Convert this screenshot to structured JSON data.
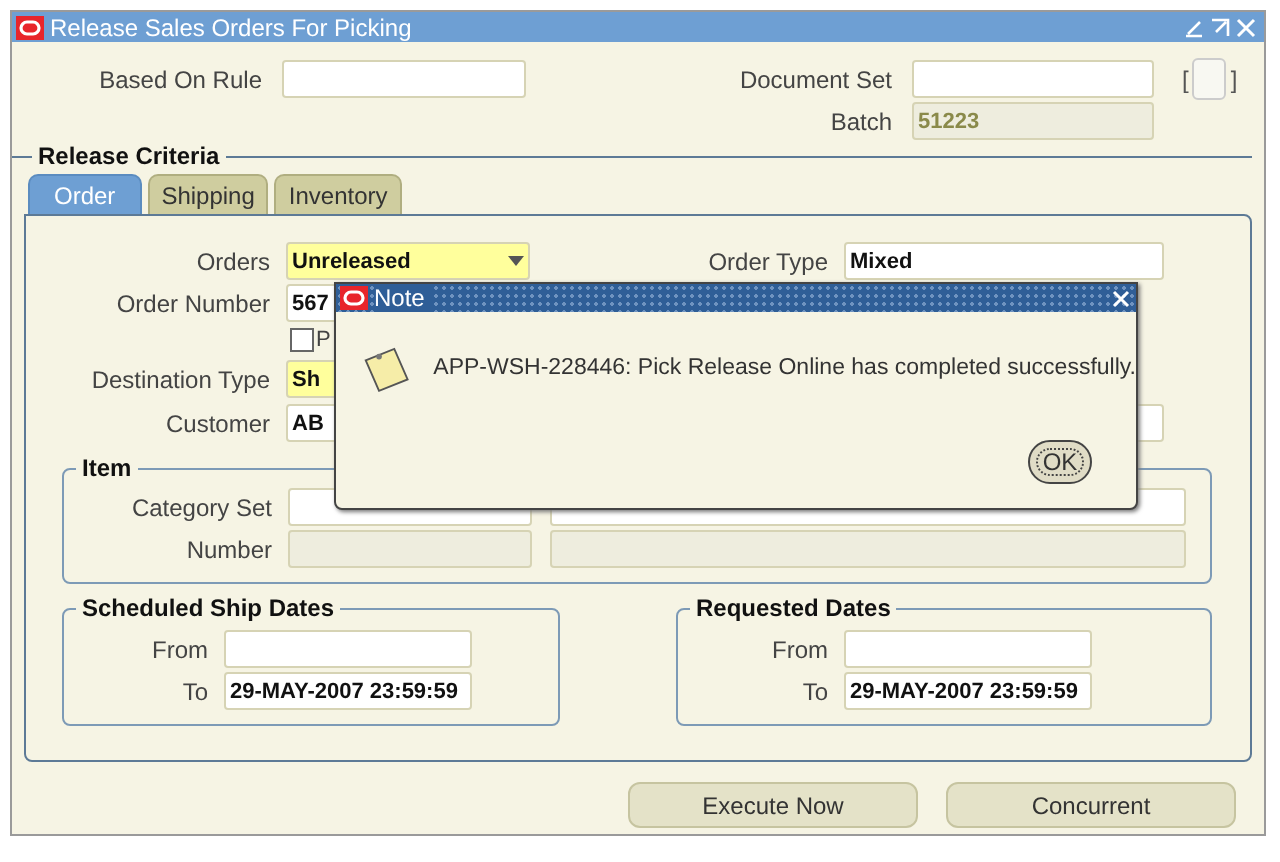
{
  "window": {
    "title": "Release Sales Orders For Picking"
  },
  "header": {
    "based_on_rule": {
      "label": "Based On Rule"
    },
    "document_set": {
      "label": "Document Set"
    },
    "flexfield": {
      "open": "[",
      "close": "]"
    },
    "batch": {
      "label": "Batch",
      "value": "51223",
      "disabled": true
    }
  },
  "release_criteria": {
    "title": "Release Criteria",
    "tabs": [
      {
        "label": "Order",
        "selected": true
      },
      {
        "label": "Shipping",
        "selected": false
      },
      {
        "label": "Inventory",
        "selected": false
      }
    ],
    "orders": {
      "label": "Orders",
      "value": "Unreleased",
      "required": true
    },
    "order_type": {
      "label": "Order Type",
      "value": "Mixed",
      "required": false
    },
    "order_number": {
      "label": "Order Number",
      "value": "567",
      "required": false
    },
    "option": {
      "label": "P",
      "checked": false
    },
    "destination_type": {
      "label": "Destination Type",
      "value": "Sh",
      "required": true
    },
    "customer": {
      "label": "Customer",
      "value": "AB",
      "required": false
    },
    "item": {
      "title": "Item",
      "category_set": {
        "label": "Category Set"
      },
      "number": {
        "label": "Number",
        "disabled": true
      }
    },
    "date_groups": [
      {
        "title": "Scheduled Ship Dates",
        "from": {
          "label": "From"
        },
        "to": {
          "label": "To",
          "value": "29-MAY-2007 23:59:59"
        }
      },
      {
        "title": "Requested Dates",
        "from": {
          "label": "From"
        },
        "to": {
          "label": "To",
          "value": "29-MAY-2007 23:59:59"
        }
      }
    ]
  },
  "buttons": [
    {
      "label": "Execute Now"
    },
    {
      "label": "Concurrent"
    }
  ],
  "dialog": {
    "title": "Note",
    "message": "APP-WSH-228446: Pick Release Online has completed successfully.",
    "button": "OK"
  }
}
